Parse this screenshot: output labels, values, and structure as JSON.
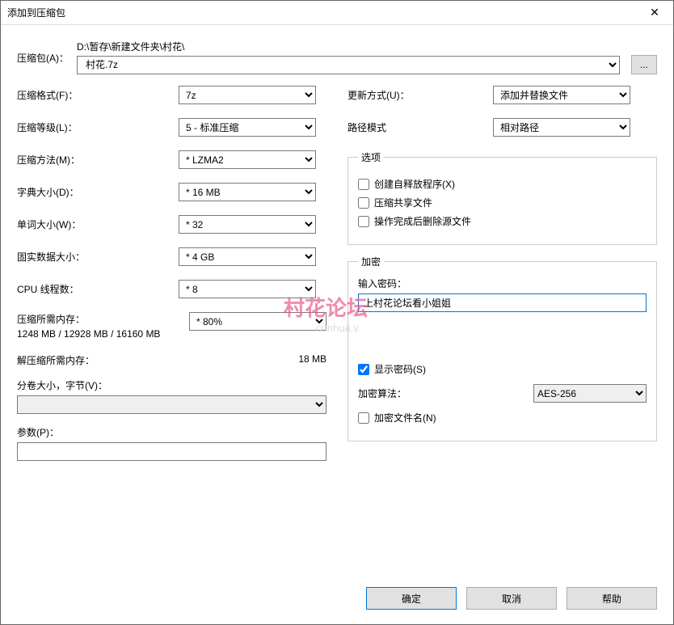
{
  "window": {
    "title": "添加到压缩包"
  },
  "archive": {
    "label": "压缩包(A)：",
    "path_text": "D:\\暂存\\新建文件夹\\村花\\",
    "filename": "村花.7z",
    "browse": "..."
  },
  "left": {
    "format_label": "压缩格式(F)：",
    "format_value": "7z",
    "level_label": "压缩等级(L)：",
    "level_value": "5 - 标准压缩",
    "method_label": "压缩方法(M)：",
    "method_value": "* LZMA2",
    "dict_label": "字典大小(D)：",
    "dict_value": "* 16 MB",
    "word_label": "单词大小(W)：",
    "word_value": "* 32",
    "solid_label": "固实数据大小：",
    "solid_value": "* 4 GB",
    "threads_label": "CPU 线程数：",
    "threads_value": "* 8",
    "mem80_value": "* 80%",
    "comp_mem_label": "压缩所需内存：",
    "comp_mem_value": "1248 MB / 12928 MB / 16160 MB",
    "decomp_mem_label": "解压缩所需内存：",
    "decomp_mem_value": "18 MB",
    "volume_label": "分卷大小，字节(V)：",
    "params_label": "参数(P)："
  },
  "right": {
    "update_label": "更新方式(U)：",
    "update_value": "添加并替换文件",
    "pathmode_label": "路径模式",
    "pathmode_value": "相对路径",
    "options_legend": "选项",
    "sfx_label": "创建自释放程序(X)",
    "shared_label": "压缩共享文件",
    "delete_after_label": "操作完成后删除源文件",
    "encrypt_legend": "加密",
    "pw_label": "输入密码：",
    "pw_value": "上村花论坛看小姐姐",
    "show_pw_label": "显示密码(S)",
    "enc_method_label": "加密算法：",
    "enc_method_value": "AES-256",
    "enc_names_label": "加密文件名(N)"
  },
  "buttons": {
    "ok": "确定",
    "cancel": "取消",
    "help": "帮助"
  },
  "watermark": {
    "main": "村花论坛",
    "sub": "cunhua.v"
  }
}
